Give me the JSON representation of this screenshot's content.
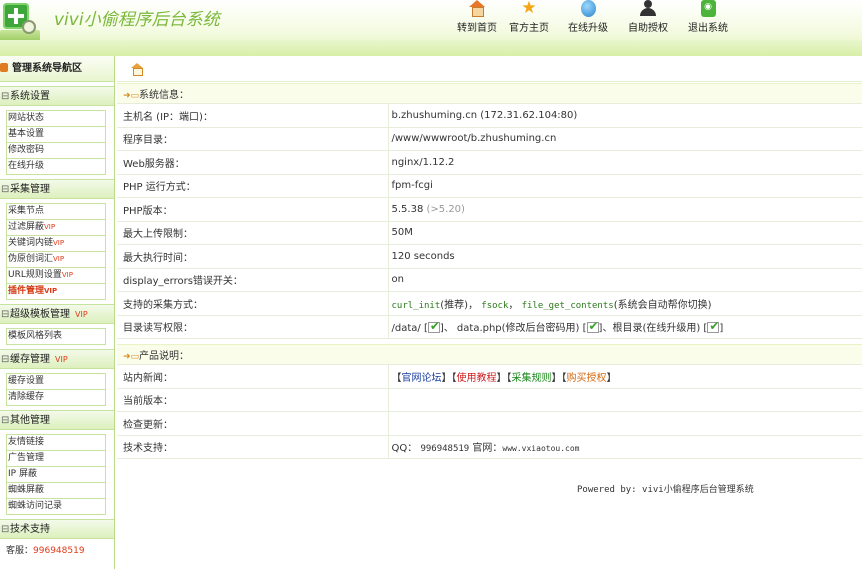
{
  "header": {
    "title": "vivi小偷程序后台系统",
    "nav": [
      {
        "label": "转到首页",
        "icon": "home-icon"
      },
      {
        "label": "官方主页",
        "icon": "star-icon"
      },
      {
        "label": "在线升级",
        "icon": "globe-icon"
      },
      {
        "label": "自助授权",
        "icon": "user-icon"
      },
      {
        "label": "退出系统",
        "icon": "rss-icon"
      }
    ]
  },
  "sidebar": {
    "title": "管理系统导航区",
    "sections": [
      {
        "title": "系统设置",
        "vip": "",
        "items": [
          {
            "label": "网站状态",
            "vip": ""
          },
          {
            "label": "基本设置",
            "vip": ""
          },
          {
            "label": "修改密码",
            "vip": ""
          },
          {
            "label": "在线升级",
            "vip": ""
          }
        ]
      },
      {
        "title": "采集管理",
        "vip": "",
        "items": [
          {
            "label": "采集节点",
            "vip": ""
          },
          {
            "label": "过滤屏蔽",
            "vip": "VIP"
          },
          {
            "label": "关键词内链",
            "vip": "VIP"
          },
          {
            "label": "伪原创词汇",
            "vip": "VIP"
          },
          {
            "label": "URL规则设置",
            "vip": "VIP"
          },
          {
            "label": "插件管理",
            "vip": "VIP"
          }
        ]
      },
      {
        "title": "超级模板管理",
        "vip": "VIP",
        "items": [
          {
            "label": "模板风格列表",
            "vip": ""
          }
        ]
      },
      {
        "title": "缓存管理",
        "vip": "VIP",
        "items": [
          {
            "label": "缓存设置",
            "vip": ""
          },
          {
            "label": "清除缓存",
            "vip": ""
          }
        ]
      },
      {
        "title": "其他管理",
        "vip": "",
        "items": [
          {
            "label": "友情链接",
            "vip": ""
          },
          {
            "label": "广告管理",
            "vip": ""
          },
          {
            "label": "IP 屏蔽",
            "vip": ""
          },
          {
            "label": "蜘蛛屏蔽",
            "vip": ""
          },
          {
            "label": "蜘蛛访问记录",
            "vip": ""
          }
        ]
      },
      {
        "title": "技术支持",
        "vip": "",
        "items": []
      }
    ],
    "support_label": "客服：",
    "support_qq": "996948519"
  },
  "system_info": {
    "section_title": "系统信息：",
    "host_label": "主机名 (IP：端口)：",
    "host_value": "b.zhushuming.cn",
    "host_ip": "(172.31.62.104:80)",
    "dir_label": "程序目录：",
    "dir_value": "/www/wwwroot/b.zhushuming.cn",
    "web_label": "Web服务器：",
    "web_value": "nginx/1.12.2",
    "phpmode_label": "PHP 运行方式：",
    "phpmode_value": "fpm-fcgi",
    "phpver_label": "PHP版本：",
    "phpver_value": "5.5.38",
    "phpver_req": "(>5.20)",
    "upload_label": "最大上传限制：",
    "upload_value": "50M",
    "exec_label": "最大执行时间：",
    "exec_value": "120 seconds",
    "errors_label": "display_errors错误开关：",
    "errors_value": "on",
    "collect_label": "支持的采集方式：",
    "collect_curl": "curl_init",
    "collect_curl_note": "(推荐)，",
    "collect_fsock": "fsock",
    "collect_sep": "，",
    "collect_fgc": "file_get_contents",
    "collect_note": "(系统会自动帮你切换)",
    "perm_label": "目录读写权限：",
    "perm_data": "/data/ [",
    "perm_mid": "]、 data.php(修改后台密码用) [",
    "perm_root": "]、根目录(在线升级用) [",
    "perm_end": "]"
  },
  "product_info": {
    "section_title": "产品说明：",
    "news_label": "站内新闻：",
    "news_links": [
      {
        "label": "官网论坛",
        "color": "#1a3ea0"
      },
      {
        "label": "使用教程",
        "color": "#d01d1d"
      },
      {
        "label": "采集规则",
        "color": "#1a8a1a"
      },
      {
        "label": "购买授权",
        "color": "#d66a12"
      }
    ],
    "version_label": "当前版本：",
    "version_value": "",
    "update_label": "检查更新：",
    "update_value": "",
    "support_label": "技术支持：",
    "support_qq_label": "QQ：",
    "support_qq": "996948519",
    "support_site_label": "官网：",
    "support_site": "www.vxiaotou.com"
  },
  "footer": {
    "powered": "Powered by:  vivi小偷程序后台管理系统"
  }
}
